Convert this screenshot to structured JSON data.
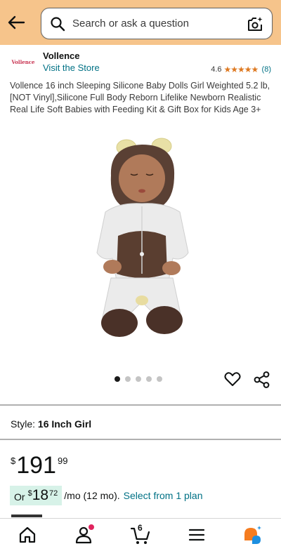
{
  "header": {
    "search_placeholder": "Search or ask a question"
  },
  "brand": {
    "logo_text": "Vollence",
    "name": "Vollence",
    "visit_store": "Visit the Store"
  },
  "rating": {
    "value": "4.6",
    "stars": 4.6,
    "count": "(8)"
  },
  "product": {
    "title": "Vollence 16 inch Sleeping Silicone Baby Dolls Girl Weighted 5.2 lb,[NOT Vinyl],Silicone Full Body Reborn Lifelike Newborn Realistic Real Life Soft Babies with Feeding Kit & Gift Box for Kids Age 3+"
  },
  "carousel": {
    "total_images": 5,
    "active_index": 0
  },
  "style": {
    "label": "Style:",
    "value": "16 Inch Girl"
  },
  "price": {
    "symbol": "$",
    "whole": "191",
    "fraction": "99"
  },
  "installment": {
    "prefix": "Or",
    "symbol": "$",
    "whole": "18",
    "fraction": "72",
    "term": "/mo (12 mo).",
    "link": "Select from 1 plan"
  },
  "bottom_nav": {
    "cart_count": "6",
    "items": [
      "home-icon",
      "account-icon",
      "cart-icon",
      "menu-icon",
      "ai-assistant-icon"
    ]
  },
  "colors": {
    "header_bg": "#f6c48b",
    "link": "#007185",
    "star": "#de7921",
    "installment_bg": "#d7f2e8",
    "notification": "#e0245e",
    "assistant_orange": "#f57c1f",
    "assistant_blue": "#1d8fe0"
  }
}
